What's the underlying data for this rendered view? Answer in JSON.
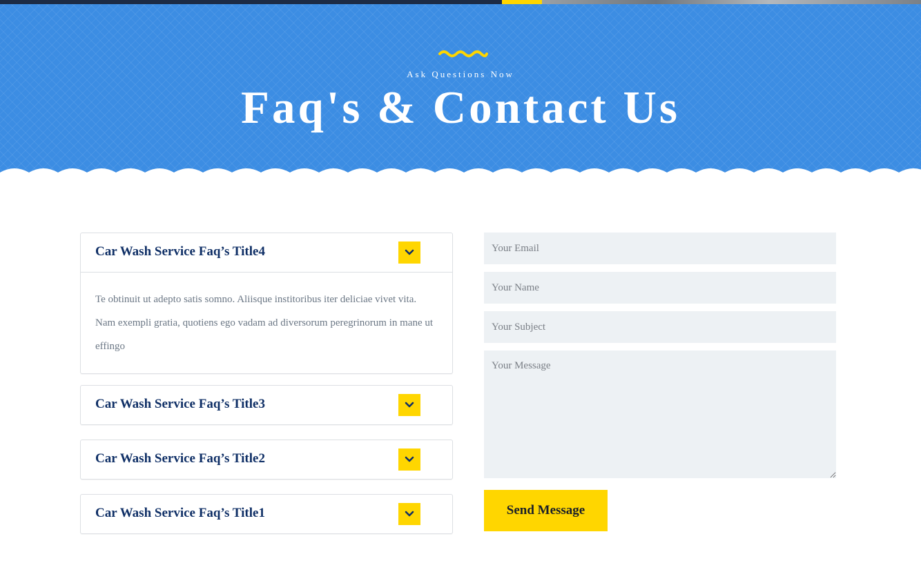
{
  "colors": {
    "hero_blue": "#3c8de3",
    "accent_yellow": "#ffd600",
    "faq_title": "#0f2f66",
    "field_bg": "#edf1f4"
  },
  "hero": {
    "subtitle": "Ask Questions Now",
    "title": "Faq's & Contact Us",
    "decor_icon": "wave-squiggle-icon"
  },
  "faq": {
    "items": [
      {
        "title": "Car Wash Service Faq’s Title4",
        "expanded": true,
        "body": "Te obtinuit ut adepto satis somno. Aliisque institoribus iter deliciae vivet vita. Nam exempli gratia, quotiens ego vadam ad diversorum peregrinorum in mane ut effingo",
        "icon": "chevron-down-icon"
      },
      {
        "title": "Car Wash Service Faq’s Title3",
        "expanded": false,
        "icon": "chevron-down-icon"
      },
      {
        "title": "Car Wash Service Faq’s Title2",
        "expanded": false,
        "icon": "chevron-down-icon"
      },
      {
        "title": "Car Wash Service Faq’s Title1",
        "expanded": false,
        "icon": "chevron-down-icon"
      }
    ]
  },
  "form": {
    "email_placeholder": "Your Email",
    "name_placeholder": "Your Name",
    "subject_placeholder": "Your Subject",
    "message_placeholder": "Your Message",
    "submit_label": "Send Message"
  }
}
